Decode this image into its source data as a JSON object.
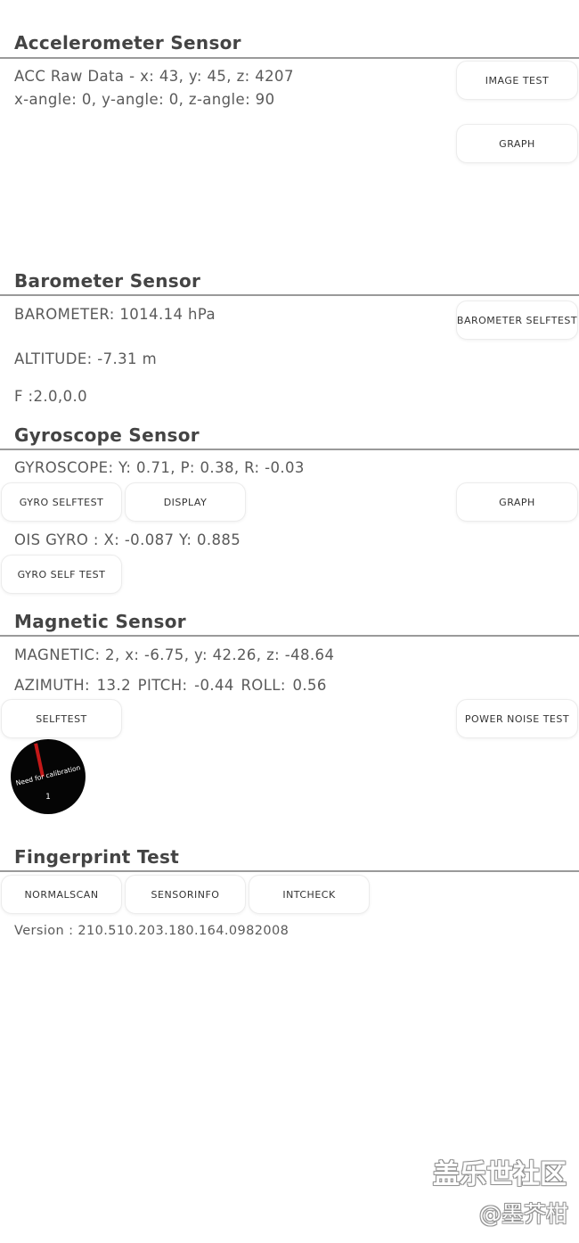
{
  "accelerometer": {
    "title": "Accelerometer Sensor",
    "raw_data": "ACC Raw Data - x: 43, y: 45, z: 4207",
    "angles": "x-angle: 0, y-angle: 0, z-angle: 90",
    "image_test_label": "IMAGE TEST",
    "graph_label": "GRAPH"
  },
  "barometer": {
    "title": "Barometer Sensor",
    "pressure": "BAROMETER: 1014.14 hPa",
    "altitude": "ALTITUDE: -7.31 m",
    "f_value": "F :2.0,0.0",
    "selftest_label": "BAROMETER SELFTEST"
  },
  "gyroscope": {
    "title": "Gyroscope Sensor",
    "reading": "GYROSCOPE: Y: 0.71, P: 0.38, R: -0.03",
    "selftest_label": "GYRO SELFTEST",
    "display_label": "DISPLAY",
    "graph_label": "GRAPH",
    "ois_reading": "OIS GYRO : X: -0.087 Y: 0.885",
    "self_test_label": "GYRO SELF TEST"
  },
  "magnetic": {
    "title": "Magnetic Sensor",
    "reading": "MAGNETIC: 2, x: -6.75, y: 42.26, z: -48.64",
    "orientation": "AZIMUTH: 13.2  PITCH: -0.44  ROLL: 0.56",
    "selftest_label": "SELFTEST",
    "power_noise_label": "POWER NOISE TEST",
    "calibration_text": "Need for calibration",
    "calibration_value": "1"
  },
  "fingerprint": {
    "title": "Fingerprint Test",
    "normalscan_label": "NORMALSCAN",
    "sensorinfo_label": "SENSORINFO",
    "intcheck_label": "INTCHECK",
    "version": "Version : 210.510.203.180.164.0982008"
  },
  "watermark": {
    "line1": "盖乐世社区",
    "line2": "@墨芥柑"
  },
  "colors": {
    "divider": "#9a9a9a",
    "compass_background": "#050505",
    "compass_needle": "#c41818"
  }
}
